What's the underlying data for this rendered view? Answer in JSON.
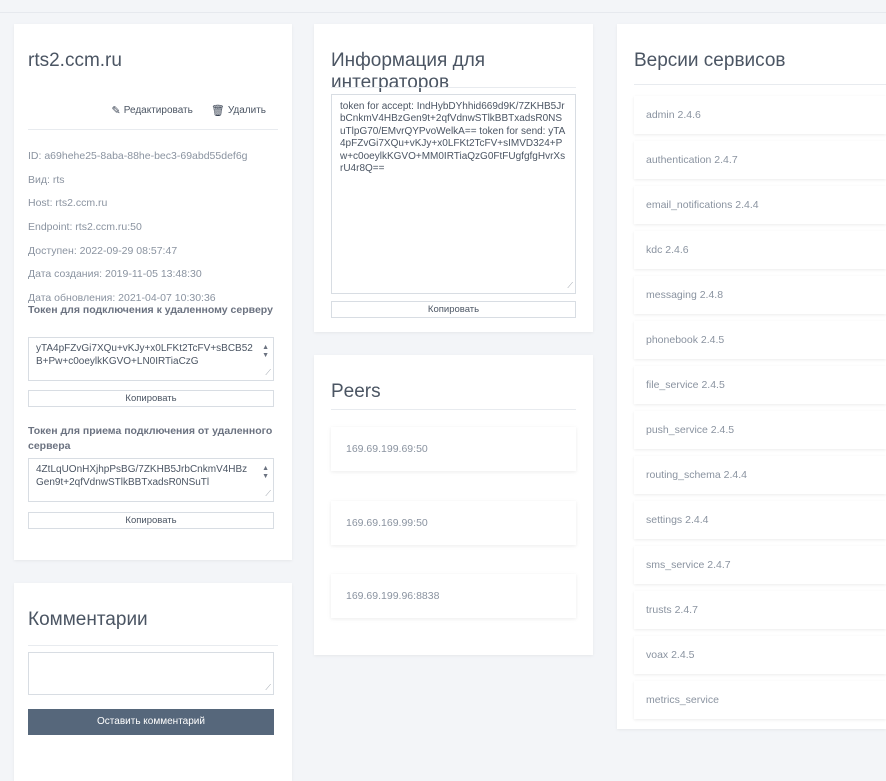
{
  "server": {
    "title": "rts2.ccm.ru",
    "edit_label": "Редактировать",
    "delete_label": "Удалить",
    "info": [
      "ID: a69hehe25-8aba-88he-bec3-69abd55def6g",
      "Вид: rts",
      "Host: rts2.ccm.ru",
      "Endpoint: rts2.ccm.ru:50",
      "Доступен: 2022-09-29 08:57:47",
      "Дата создания: 2019-11-05 13:48:30",
      "Дата обновления: 2021-04-07 10:30:36"
    ],
    "token_connect_label": "Токен для подключения к удаленному серверу",
    "token_connect_value": "yTA4pFZvGi7XQu+vKJy+x0LFKt2TcFV+sBCB52B+Pw+c0oeylkKGVO+LN0IRTiaCzG",
    "token_receive_label": "Токен для приема подключения от удаленного сервера",
    "token_receive_value": "4ZtLqUOnHXjhpPsBG/7ZKHB5JrbCnkmV4HBzGen9t+2qfVdnwSTlkBBTxadsR0NSuTl",
    "copy_label": "Копировать"
  },
  "comments": {
    "title": "Комментарии",
    "submit_label": "Оставить комментарий"
  },
  "integrators": {
    "title": "Информация для интеграторов",
    "text": "token for accept: IndHybDYhhid669d9K/7ZKHB5JrbCnkmV4HBzGen9t+2qfVdnwSTlkBBTxadsR0NSuTlpG70/EMvrQYPvoWelkA== token for send: yTA4pFZvGi7XQu+vKJy+x0LFKt2TcFV+sIMVD324+Pw+c0oeylkKGVO+MM0IRTiaQzG0FtFUgfgfgHvrXsrU4r8Q==",
    "copy_label": "Копировать"
  },
  "peers": {
    "title": "Peers",
    "items": [
      "169.69.199.69:50",
      "169.69.169.99:50",
      "169.69.199.96:8838"
    ]
  },
  "versions": {
    "title": "Версии сервисов",
    "items": [
      "admin 2.4.6",
      "authentication 2.4.7",
      "email_notifications 2.4.4",
      "kdc 2.4.6",
      "messaging 2.4.8",
      "phonebook 2.4.5",
      "file_service 2.4.5",
      "push_service 2.4.5",
      "routing_schema 2.4.4",
      "settings 2.4.4",
      "sms_service 2.4.7",
      "trusts 2.4.7",
      "voax 2.4.5",
      "metrics_service"
    ]
  }
}
